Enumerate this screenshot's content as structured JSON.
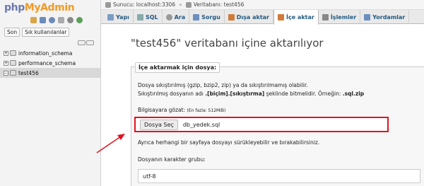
{
  "sidebar": {
    "logo": {
      "php": "php",
      "my": "My",
      "admin": "Admin"
    },
    "tabs": [
      "Son",
      "Sık kullanılanlar"
    ],
    "databases": [
      {
        "name": "information_schema",
        "selected": false
      },
      {
        "name": "performance_schema",
        "selected": false
      },
      {
        "name": "test456",
        "selected": true
      }
    ]
  },
  "breadcrumb": {
    "server": "Sunucu: localhost:3306",
    "database": "Veritabanı: test456"
  },
  "topnav": {
    "tabs": [
      {
        "label": "Yapı",
        "active": false
      },
      {
        "label": "SQL",
        "active": false
      },
      {
        "label": "Ara",
        "active": false
      },
      {
        "label": "Sorgu",
        "active": false
      },
      {
        "label": "Dışa aktar",
        "active": false
      },
      {
        "label": "İçe aktar",
        "active": true
      },
      {
        "label": "İşlemler",
        "active": false
      },
      {
        "label": "Yordamlar",
        "active": false
      }
    ]
  },
  "main": {
    "title": "\"test456\" veritabanı içine aktarılıyor",
    "legend": "İçe aktarmak için dosya:",
    "info1": "Dosya sıkıştırılmış (gzip, bzip2, zip) ya da sıkıştırılmamış olabilir.",
    "info2_pre": "Sıkıştırılmış dosyanın adı ",
    "info2_bold": ".[biçim].[sıkıştırma]",
    "info2_mid": " şeklinde bitmelidir. Örneğin: ",
    "info2_ex": ".sql.zip",
    "browse_label": "Bilgisayara gözat:",
    "max_size": "(En fazla: 512MiB)",
    "file_button": "Dosya Seç",
    "file_name": "db_yedek.sql",
    "drag_text": "Ayrıca herhangi bir sayfaya dosyayı sürükleyebilir ve bırakabilirsiniz.",
    "charset_label": "Dosyanın karakter grubu:",
    "charset_value": "utf-8"
  },
  "colors": {
    "highlight_border": "#e1131f",
    "arrow": "#e1131f",
    "link": "#235a81"
  }
}
